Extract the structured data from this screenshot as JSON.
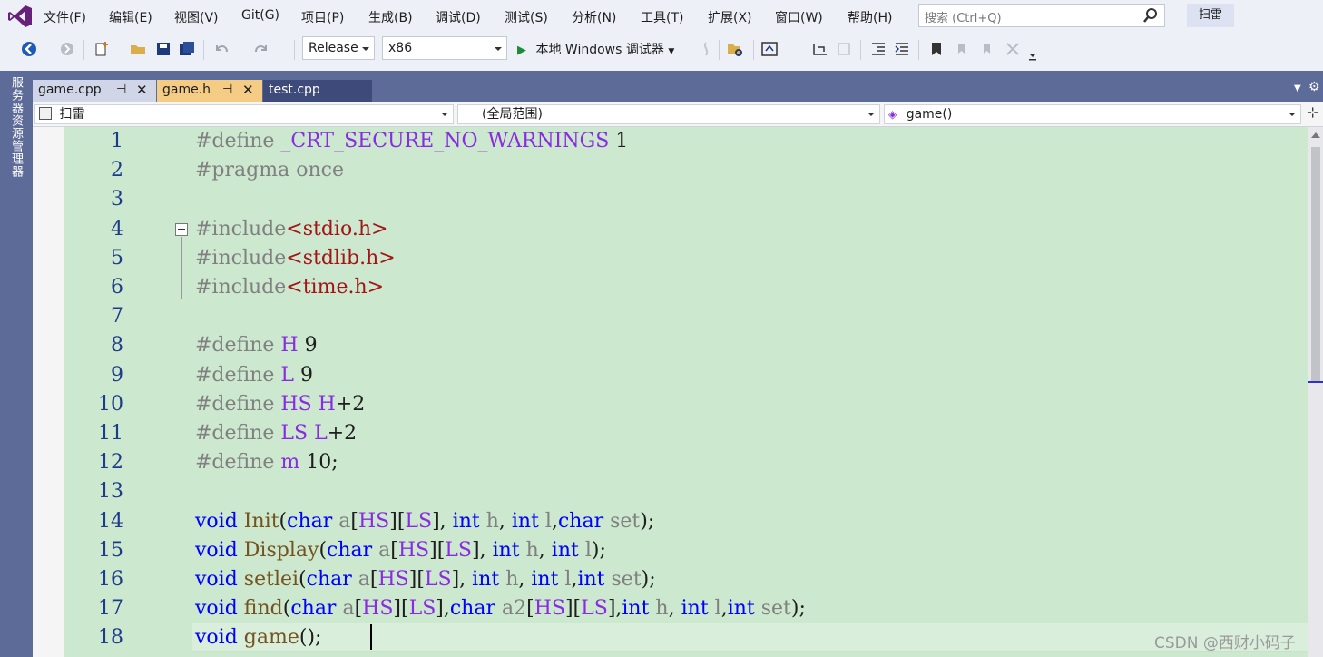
{
  "menu": [
    "文件(F)",
    "编辑(E)",
    "视图(V)",
    "Git(G)",
    "项目(P)",
    "生成(B)",
    "调试(D)",
    "测试(S)",
    "分析(N)",
    "工具(T)",
    "扩展(X)",
    "窗口(W)",
    "帮助(H)"
  ],
  "search": {
    "placeholder": "搜索 (Ctrl+Q)"
  },
  "project_name": "扫雷",
  "toolbar": {
    "config": "Release",
    "platform": "x86",
    "debugger": "本地 Windows 调试器"
  },
  "side_panel_label": "服务器资源管理器",
  "tabs": [
    {
      "label": "game.cpp",
      "pin": "⊣",
      "close": "✕"
    },
    {
      "label": "game.h",
      "pin": "⊣",
      "close": "✕"
    },
    {
      "label": "test.cpp"
    }
  ],
  "navbar": {
    "project": "扫雷",
    "scope": "(全局范围)",
    "member": "game()"
  },
  "code_lines": [
    {
      "n": "1",
      "tokens": [
        [
          "pp",
          "#define "
        ],
        [
          "mac",
          "_CRT_SECURE_NO_WARNINGS"
        ],
        [
          "id",
          " 1"
        ]
      ]
    },
    {
      "n": "2",
      "tokens": [
        [
          "pp",
          "#pragma once"
        ]
      ]
    },
    {
      "n": "3",
      "tokens": []
    },
    {
      "n": "4",
      "tokens": [
        [
          "pp",
          "#include"
        ],
        [
          "str",
          "<stdio.h>"
        ]
      ]
    },
    {
      "n": "5",
      "tokens": [
        [
          "pp",
          "#include"
        ],
        [
          "str",
          "<stdlib.h>"
        ]
      ]
    },
    {
      "n": "6",
      "tokens": [
        [
          "pp",
          "#include"
        ],
        [
          "str",
          "<time.h>"
        ]
      ]
    },
    {
      "n": "7",
      "tokens": []
    },
    {
      "n": "8",
      "tokens": [
        [
          "pp",
          "#define "
        ],
        [
          "mac",
          "H"
        ],
        [
          "id",
          " 9"
        ]
      ]
    },
    {
      "n": "9",
      "tokens": [
        [
          "pp",
          "#define "
        ],
        [
          "mac",
          "L"
        ],
        [
          "id",
          " 9"
        ]
      ]
    },
    {
      "n": "10",
      "tokens": [
        [
          "pp",
          "#define "
        ],
        [
          "mac",
          "HS"
        ],
        [
          "id",
          " "
        ],
        [
          "mac",
          "H"
        ],
        [
          "id",
          "+2"
        ]
      ]
    },
    {
      "n": "11",
      "tokens": [
        [
          "pp",
          "#define "
        ],
        [
          "mac",
          "LS"
        ],
        [
          "id",
          " "
        ],
        [
          "mac",
          "L"
        ],
        [
          "id",
          "+2"
        ]
      ]
    },
    {
      "n": "12",
      "tokens": [
        [
          "pp",
          "#define "
        ],
        [
          "mac",
          "m"
        ],
        [
          "id",
          " 10;"
        ]
      ]
    },
    {
      "n": "13",
      "tokens": []
    },
    {
      "n": "14",
      "tokens": [
        [
          "kw",
          "void"
        ],
        [
          "id",
          " "
        ],
        [
          "fn",
          "Init"
        ],
        [
          "id",
          "("
        ],
        [
          "kw",
          "char"
        ],
        [
          "pm",
          " a"
        ],
        [
          "id",
          "["
        ],
        [
          "mac",
          "HS"
        ],
        [
          "id",
          "]["
        ],
        [
          "mac",
          "LS"
        ],
        [
          "id",
          "], "
        ],
        [
          "kw",
          "int"
        ],
        [
          "pm",
          " h"
        ],
        [
          "id",
          ", "
        ],
        [
          "kw",
          "int"
        ],
        [
          "pm",
          " l"
        ],
        [
          "id",
          ","
        ],
        [
          "kw",
          "char"
        ],
        [
          "pm",
          " set"
        ],
        [
          "id",
          ");"
        ]
      ]
    },
    {
      "n": "15",
      "tokens": [
        [
          "kw",
          "void"
        ],
        [
          "id",
          " "
        ],
        [
          "fn",
          "Display"
        ],
        [
          "id",
          "("
        ],
        [
          "kw",
          "char"
        ],
        [
          "pm",
          " a"
        ],
        [
          "id",
          "["
        ],
        [
          "mac",
          "HS"
        ],
        [
          "id",
          "]["
        ],
        [
          "mac",
          "LS"
        ],
        [
          "id",
          "], "
        ],
        [
          "kw",
          "int"
        ],
        [
          "pm",
          " h"
        ],
        [
          "id",
          ", "
        ],
        [
          "kw",
          "int"
        ],
        [
          "pm",
          " l"
        ],
        [
          "id",
          ");"
        ]
      ]
    },
    {
      "n": "16",
      "tokens": [
        [
          "kw",
          "void"
        ],
        [
          "id",
          " "
        ],
        [
          "fn",
          "setlei"
        ],
        [
          "id",
          "("
        ],
        [
          "kw",
          "char"
        ],
        [
          "pm",
          " a"
        ],
        [
          "id",
          "["
        ],
        [
          "mac",
          "HS"
        ],
        [
          "id",
          "]["
        ],
        [
          "mac",
          "LS"
        ],
        [
          "id",
          "], "
        ],
        [
          "kw",
          "int"
        ],
        [
          "pm",
          " h"
        ],
        [
          "id",
          ", "
        ],
        [
          "kw",
          "int"
        ],
        [
          "pm",
          " l"
        ],
        [
          "id",
          ","
        ],
        [
          "kw",
          "int"
        ],
        [
          "pm",
          " set"
        ],
        [
          "id",
          ");"
        ]
      ]
    },
    {
      "n": "17",
      "tokens": [
        [
          "kw",
          "void"
        ],
        [
          "id",
          " "
        ],
        [
          "fn",
          "find"
        ],
        [
          "id",
          "("
        ],
        [
          "kw",
          "char"
        ],
        [
          "pm",
          " a"
        ],
        [
          "id",
          "["
        ],
        [
          "mac",
          "HS"
        ],
        [
          "id",
          "]["
        ],
        [
          "mac",
          "LS"
        ],
        [
          "id",
          "],"
        ],
        [
          "kw",
          "char"
        ],
        [
          "pm",
          " a2"
        ],
        [
          "id",
          "["
        ],
        [
          "mac",
          "HS"
        ],
        [
          "id",
          "]["
        ],
        [
          "mac",
          "LS"
        ],
        [
          "id",
          "],"
        ],
        [
          "kw",
          "int"
        ],
        [
          "pm",
          " h"
        ],
        [
          "id",
          ", "
        ],
        [
          "kw",
          "int"
        ],
        [
          "pm",
          " l"
        ],
        [
          "id",
          ","
        ],
        [
          "kw",
          "int"
        ],
        [
          "pm",
          " set"
        ],
        [
          "id",
          ");"
        ]
      ]
    },
    {
      "n": "18",
      "tokens": [
        [
          "kw",
          "void"
        ],
        [
          "id",
          " "
        ],
        [
          "fn",
          "game"
        ],
        [
          "id",
          "();"
        ]
      ]
    }
  ],
  "watermark": "CSDN @西财小码子",
  "colors": {
    "editor_bg": "#cce8cf",
    "keyword": "#0000ff",
    "macro": "#8a2be2",
    "string": "#a31515",
    "accent": "#5d6b99"
  }
}
